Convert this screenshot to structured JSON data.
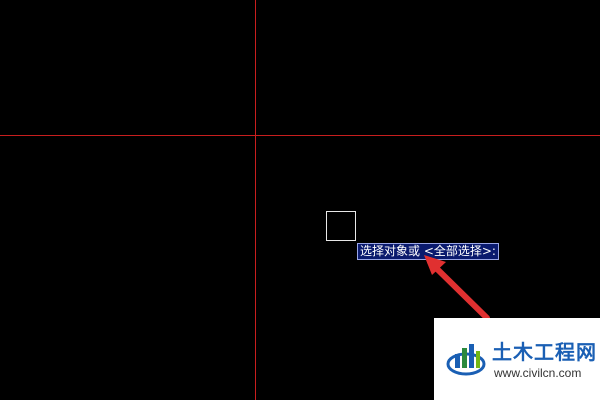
{
  "cad_view": {
    "background_color": "#000000",
    "crosshair_color": "#c81e1e",
    "pickbox_color": "#e8e8e8"
  },
  "tooltip": {
    "text": "选择对象或 <全部选择>:",
    "background_color": "#0a1a6e"
  },
  "annotation": {
    "arrow_color": "#e03030",
    "arrow_icon": "red-arrow-icon"
  },
  "watermark": {
    "title": "土木工程网",
    "url": "www.civilcn.com",
    "logo_icon": "civilcn-logo-icon",
    "brand_color": "#1a5fb4"
  }
}
